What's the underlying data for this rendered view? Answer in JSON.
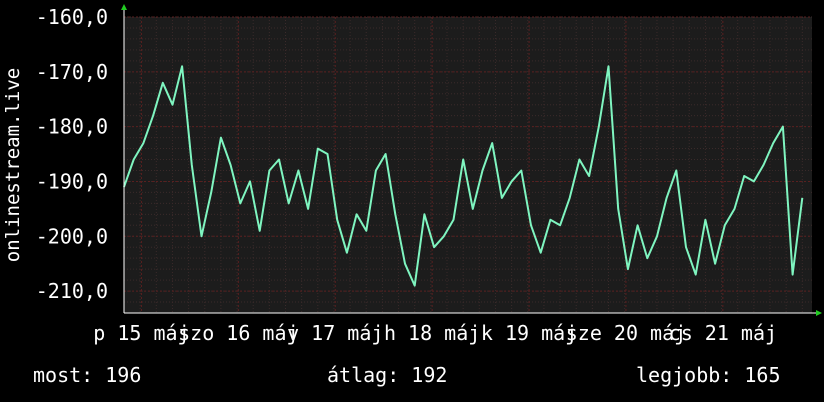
{
  "chart_data": {
    "type": "line",
    "ylabel": "onlinestream.live",
    "ylim": [
      -214,
      -160
    ],
    "y_ticks": [
      {
        "value": -160,
        "label": "-160,0"
      },
      {
        "value": -170,
        "label": "-170,0"
      },
      {
        "value": -180,
        "label": "-180,0"
      },
      {
        "value": -190,
        "label": "-190,0"
      },
      {
        "value": -200,
        "label": "-200,0"
      },
      {
        "value": -210,
        "label": "-210,0"
      }
    ],
    "xlim": [
      0,
      7.1
    ],
    "x_ticks": [
      {
        "value": 0.18,
        "label": "p 15 máj"
      },
      {
        "value": 1.18,
        "label": "szo 16 máj"
      },
      {
        "value": 2.18,
        "label": "v 17 máj"
      },
      {
        "value": 3.18,
        "label": "h 18 máj"
      },
      {
        "value": 4.18,
        "label": "k 19 máj"
      },
      {
        "value": 5.18,
        "label": "sze 20 máj"
      },
      {
        "value": 6.18,
        "label": "cs 21 máj"
      }
    ],
    "series": [
      {
        "color": "#7ff5c0",
        "x": [
          0.0,
          0.1,
          0.2,
          0.3,
          0.4,
          0.5,
          0.6,
          0.7,
          0.8,
          0.9,
          1.0,
          1.1,
          1.2,
          1.3,
          1.4,
          1.5,
          1.6,
          1.7,
          1.8,
          1.9,
          2.0,
          2.1,
          2.2,
          2.3,
          2.4,
          2.5,
          2.6,
          2.7,
          2.8,
          2.9,
          3.0,
          3.1,
          3.2,
          3.3,
          3.4,
          3.5,
          3.6,
          3.7,
          3.8,
          3.9,
          4.0,
          4.1,
          4.2,
          4.3,
          4.4,
          4.5,
          4.6,
          4.7,
          4.8,
          4.9,
          5.0,
          5.1,
          5.2,
          5.3,
          5.4,
          5.5,
          5.6,
          5.7,
          5.8,
          5.9,
          6.0,
          6.1,
          6.2,
          6.3,
          6.4,
          6.5,
          6.6,
          6.7,
          6.8,
          6.9,
          7.0
        ],
        "values": [
          -191,
          -186,
          -183,
          -178,
          -172,
          -176,
          -169,
          -187,
          -200,
          -192,
          -182,
          -187,
          -194,
          -190,
          -199,
          -188,
          -186,
          -194,
          -188,
          -195,
          -184,
          -185,
          -197,
          -203,
          -196,
          -199,
          -188,
          -185,
          -196,
          -205,
          -209,
          -196,
          -202,
          -200,
          -197,
          -186,
          -195,
          -188,
          -183,
          -193,
          -190,
          -188,
          -198,
          -203,
          -197,
          -198,
          -193,
          -186,
          -189,
          -180,
          -169,
          -195,
          -206,
          -198,
          -204,
          -200,
          -193,
          -188,
          -202,
          -207,
          -197,
          -205,
          -198,
          -195,
          -189,
          -190,
          -187,
          -183,
          -180,
          -207,
          -193
        ]
      }
    ]
  },
  "stats": {
    "current": "most: 196",
    "average": "átlag: 192",
    "best": "legjobb: 165"
  },
  "colors": {
    "background": "#000000",
    "plot_background": "#1c1c1c",
    "grid_major": "#5a1f1f",
    "grid_minor": "#3a2a2a",
    "line": "#7ff5c0",
    "arrow": "#22cc22",
    "text": "#ffffff"
  }
}
